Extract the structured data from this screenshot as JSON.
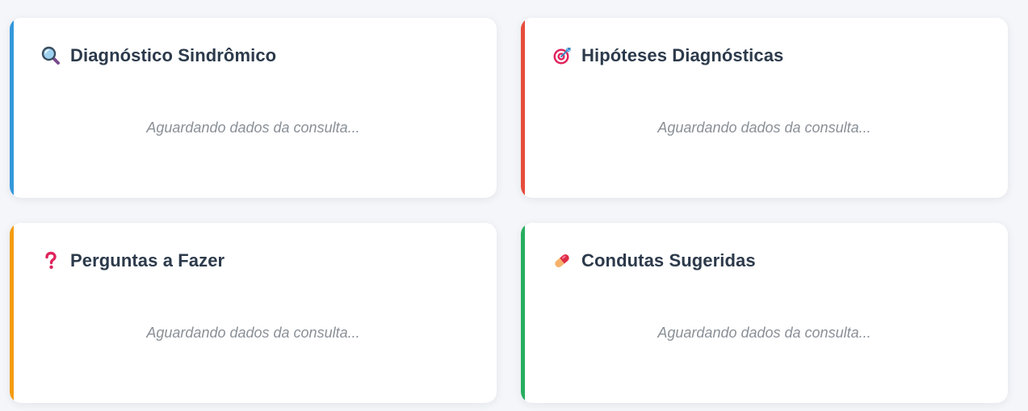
{
  "cards": [
    {
      "title": "Diagnóstico Sindrômico",
      "icon": "magnifying-glass-icon",
      "accent_color": "#3498db",
      "placeholder": "Aguardando dados da consulta..."
    },
    {
      "title": "Hipóteses Diagnósticas",
      "icon": "target-dart-icon",
      "accent_color": "#e74c3c",
      "placeholder": "Aguardando dados da consulta..."
    },
    {
      "title": "Perguntas a Fazer",
      "icon": "question-mark-icon",
      "accent_color": "#f39c12",
      "placeholder": "Aguardando dados da consulta..."
    },
    {
      "title": "Condutas Sugeridas",
      "icon": "pill-icon",
      "accent_color": "#27ae60",
      "placeholder": "Aguardando dados da consulta..."
    }
  ]
}
